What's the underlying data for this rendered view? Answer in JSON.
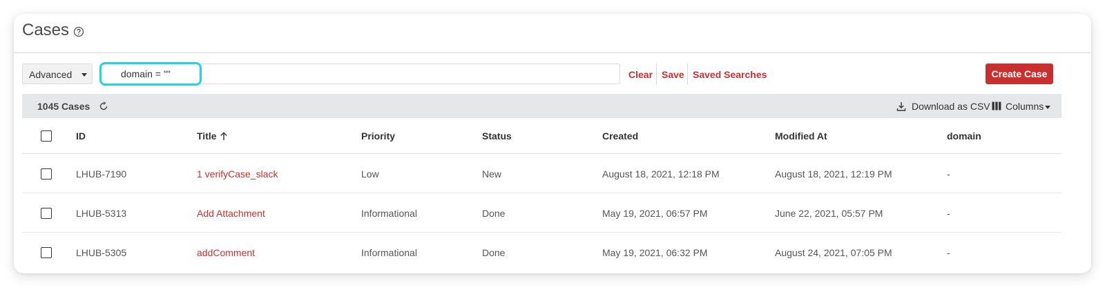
{
  "page": {
    "title": "Cases"
  },
  "toolbar": {
    "mode": "Advanced",
    "query": "domain = \"\"",
    "clear_label": "Clear",
    "save_label": "Save",
    "saved_searches_label": "Saved Searches",
    "create_label": "Create Case"
  },
  "summary": {
    "count_label": "1045 Cases",
    "download_label": "Download as CSV",
    "columns_label": "Columns"
  },
  "table": {
    "headers": [
      "ID",
      "Title",
      "Priority",
      "Status",
      "Created",
      "Modified At",
      "domain"
    ],
    "sort_column": "Title",
    "rows": [
      {
        "id": "LHUB-7190",
        "title": "1 verifyCase_slack",
        "priority": "Low",
        "status": "New",
        "created": "August 18, 2021, 12:18 PM",
        "modified": "August 18, 2021, 12:19 PM",
        "domain": "-"
      },
      {
        "id": "LHUB-5313",
        "title": "Add Attachment",
        "priority": "Informational",
        "status": "Done",
        "created": "May 19, 2021, 06:57 PM",
        "modified": "June 22, 2021, 05:57 PM",
        "domain": "-"
      },
      {
        "id": "LHUB-5305",
        "title": "addComment",
        "priority": "Informational",
        "status": "Done",
        "created": "May 19, 2021, 06:32 PM",
        "modified": "August 24, 2021, 07:05 PM",
        "domain": "-"
      }
    ]
  },
  "colors": {
    "accent": "#c8302f",
    "highlight": "#1fd6dd",
    "summary_bg": "#e5e7e8"
  },
  "icons": {
    "help": "question-circle-icon",
    "refresh": "refresh-icon",
    "download": "download-icon",
    "columns": "columns-icon",
    "sort": "arrow-up-icon",
    "select_caret": "caret-down-icon"
  }
}
